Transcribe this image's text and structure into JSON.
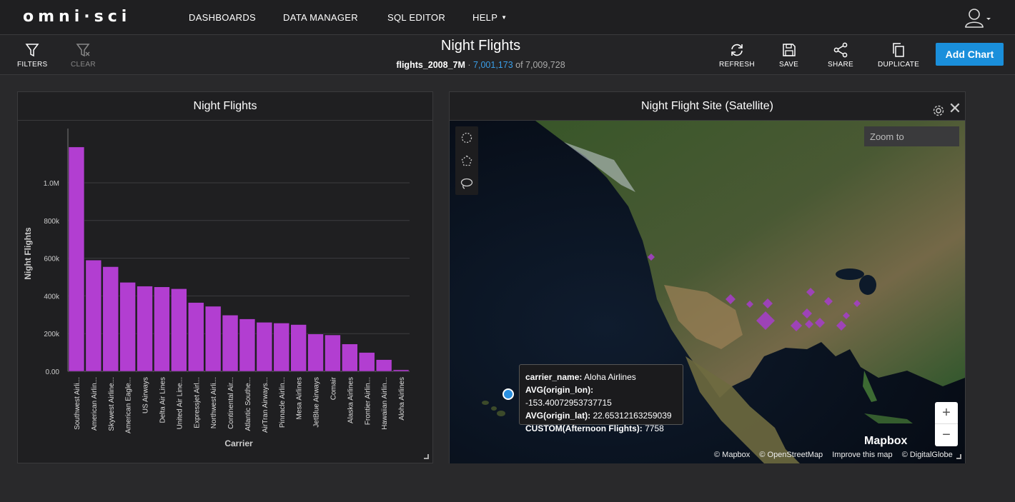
{
  "app": {
    "logo": "omni·sci"
  },
  "nav": {
    "items": [
      "DASHBOARDS",
      "DATA MANAGER",
      "SQL EDITOR",
      "HELP"
    ]
  },
  "toolbar": {
    "filters_label": "FILTERS",
    "clear_label": "CLEAR",
    "refresh_label": "REFRESH",
    "save_label": "SAVE",
    "share_label": "SHARE",
    "duplicate_label": "DUPLICATE",
    "add_chart_label": "Add Chart"
  },
  "dashboard": {
    "title": "Night Flights",
    "table": "flights_2008_7M",
    "separator": "·",
    "filtered_count": "7,001,173",
    "of_text": "of 7,009,728"
  },
  "bar_panel": {
    "title": "Night Flights"
  },
  "chart_data": {
    "type": "bar",
    "title": "Night Flights",
    "xlabel": "Carrier",
    "ylabel": "Night Flights",
    "categories": [
      "Southwest Airli...",
      "American Airlin...",
      "Skywest Airline...",
      "American Eagle...",
      "US Airways",
      "Delta Air Lines",
      "United Air Line...",
      "Expressjet Airl...",
      "Northwest Airli...",
      "Continental Air...",
      "Atlantic Southe...",
      "AirTran Airways...",
      "Pinnacle Airlin...",
      "Mesa Airlines",
      "JetBlue Airways",
      "Comair",
      "Alaska Airlines",
      "Frontier Airlin...",
      "Hawaiian Airlin...",
      "Aloha Airlines"
    ],
    "values": [
      1190000,
      590000,
      555000,
      472000,
      452000,
      448000,
      438000,
      365000,
      345000,
      298000,
      278000,
      260000,
      256000,
      248000,
      198000,
      193000,
      145000,
      100000,
      62000,
      8000
    ],
    "ylim": [
      0,
      1250000
    ],
    "yticks": [
      0,
      200000,
      400000,
      600000,
      800000,
      1000000
    ],
    "ytick_labels": [
      "0.00",
      "200k",
      "400k",
      "600k",
      "800k",
      "1.0M"
    ],
    "color": "#b23ed1",
    "grid": true
  },
  "map_panel": {
    "title": "Night Flight Site (Satellite)",
    "zoom_placeholder": "Zoom to",
    "zoom_in": "+",
    "zoom_out": "−",
    "mapbox_logo": "Mapbox",
    "attributions": [
      "© Mapbox",
      "© OpenStreetMap",
      "Improve this map",
      "© DigitalGlobe"
    ],
    "tooltip": {
      "rows": [
        {
          "key": "carrier_name:",
          "value": "Aloha Airlines"
        },
        {
          "key": "AVG(origin_lon):",
          "value": "-153.40072953737715"
        },
        {
          "key": "AVG(origin_lat):",
          "value": "22.65312163259039"
        },
        {
          "key": "CUSTOM(Afternoon Flights):",
          "value": "7758"
        }
      ]
    },
    "marker_color": "#a33fc4"
  }
}
